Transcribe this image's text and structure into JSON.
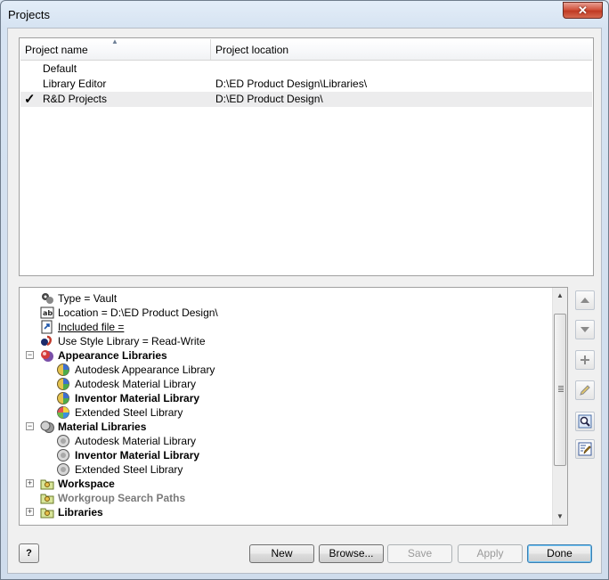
{
  "window": {
    "title": "Projects",
    "close_glyph": "✕"
  },
  "projects": {
    "columns": [
      "Project name",
      "Project location"
    ],
    "rows": [
      {
        "name": "Default",
        "location": "",
        "active": false
      },
      {
        "name": "Library Editor",
        "location": "D:\\ED Product Design\\Libraries\\",
        "active": false
      },
      {
        "name": "R&D Projects",
        "location": "D:\\ED Product Design\\",
        "active": true
      }
    ],
    "active_mark": "✓"
  },
  "tree": {
    "items": [
      {
        "label": "Type = Vault",
        "icon": "vault-type-icon",
        "level": 1
      },
      {
        "label": "Location = D:\\ED Product Design\\",
        "icon": "text-field-icon",
        "level": 1
      },
      {
        "label": "Included file = ",
        "icon": "included-file-icon",
        "level": 1
      },
      {
        "label": "Use Style Library = Read-Write",
        "icon": "style-library-icon",
        "level": 1
      },
      {
        "label": "Appearance Libraries",
        "icon": "appearance-libraries-icon",
        "level": 1,
        "expander": "−"
      },
      {
        "label": "Autodesk Appearance Library",
        "icon": "appearance-library-icon",
        "level": 2
      },
      {
        "label": "Autodesk Material Library",
        "icon": "appearance-library-icon",
        "level": 2
      },
      {
        "label": "Inventor Material Library",
        "icon": "appearance-library-icon",
        "level": 2
      },
      {
        "label": "Extended Steel Library",
        "icon": "appearance-library-color-icon",
        "level": 2
      },
      {
        "label": "Material Libraries",
        "icon": "material-libraries-icon",
        "level": 1,
        "expander": "−"
      },
      {
        "label": "Autodesk Material Library",
        "icon": "material-library-icon",
        "level": 2
      },
      {
        "label": "Inventor Material Library",
        "icon": "material-library-icon",
        "level": 2
      },
      {
        "label": "Extended Steel Library",
        "icon": "material-library-icon",
        "level": 2
      },
      {
        "label": "Workspace",
        "icon": "folder-icon",
        "level": 1,
        "expander": "+"
      },
      {
        "label": "Workgroup Search Paths",
        "icon": "folder-icon",
        "level": 1
      },
      {
        "label": "Libraries",
        "icon": "folder-icon",
        "level": 1,
        "expander": "+"
      }
    ]
  },
  "tools": [
    "move-up-icon",
    "move-down-icon",
    "add-icon",
    "edit-icon",
    "find-icon",
    "edit-settings-icon"
  ],
  "buttons": {
    "help": "?",
    "new": "New",
    "browse": "Browse...",
    "save": "Save",
    "apply": "Apply",
    "done": "Done"
  }
}
